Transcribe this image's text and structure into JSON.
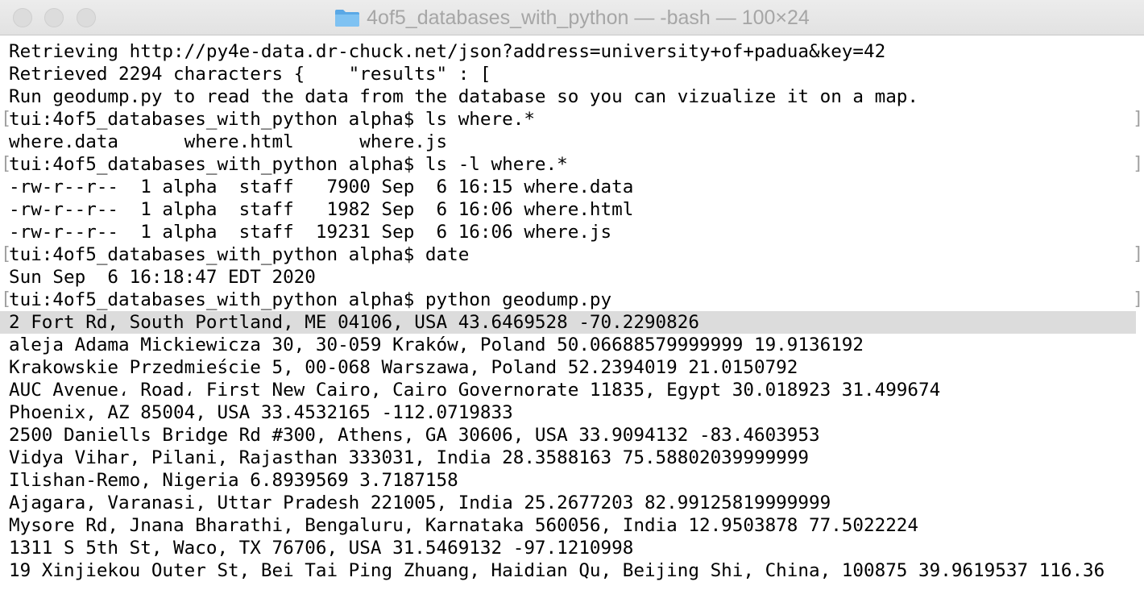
{
  "window": {
    "title": "4of5_databases_with_python — -bash — 100×24",
    "folder_icon": "folder-icon",
    "colors": {
      "titlebar": "#e6e6e6",
      "title_text": "#a6a6a6",
      "highlight": "#dcdcdc",
      "folder": "#6fb3e8"
    }
  },
  "terminal": {
    "lines": [
      {
        "text": "Retrieving http://py4e-data.dr-chuck.net/json?address=university+of+padua&key=42",
        "kind": "output"
      },
      {
        "text": "Retrieved 2294 characters {    \"results\" : [",
        "kind": "output"
      },
      {
        "text": "Run geodump.py to read the data from the database so you can vizualize it on a map.",
        "kind": "output"
      },
      {
        "text": "tui:4of5_databases_with_python alpha$ ls where.*",
        "kind": "prompt"
      },
      {
        "text": "where.data      where.html      where.js",
        "kind": "output"
      },
      {
        "text": "tui:4of5_databases_with_python alpha$ ls -l where.*",
        "kind": "prompt"
      },
      {
        "text": "-rw-r--r--  1 alpha  staff   7900 Sep  6 16:15 where.data",
        "kind": "output"
      },
      {
        "text": "-rw-r--r--  1 alpha  staff   1982 Sep  6 16:06 where.html",
        "kind": "output"
      },
      {
        "text": "-rw-r--r--  1 alpha  staff  19231 Sep  6 16:06 where.js",
        "kind": "output"
      },
      {
        "text": "tui:4of5_databases_with_python alpha$ date",
        "kind": "prompt"
      },
      {
        "text": "Sun Sep  6 16:18:47 EDT 2020",
        "kind": "output"
      },
      {
        "text": "tui:4of5_databases_with_python alpha$ python geodump.py",
        "kind": "prompt"
      },
      {
        "text": "2 Fort Rd, South Portland, ME 04106, USA 43.6469528 -70.2290826",
        "kind": "highlight"
      },
      {
        "text": "aleja Adama Mickiewicza 30, 30-059 Kraków, Poland 50.06688579999999 19.9136192",
        "kind": "output"
      },
      {
        "text": "Krakowskie Przedmieście 5, 00-068 Warszawa, Poland 52.2394019 21.0150792",
        "kind": "output"
      },
      {
        "text": "AUC Avenue، Road، First New Cairo, Cairo Governorate 11835, Egypt 30.018923 31.499674",
        "kind": "output"
      },
      {
        "text": "Phoenix, AZ 85004, USA 33.4532165 -112.0719833",
        "kind": "output"
      },
      {
        "text": "2500 Daniells Bridge Rd #300, Athens, GA 30606, USA 33.9094132 -83.4603953",
        "kind": "output"
      },
      {
        "text": "Vidya Vihar, Pilani, Rajasthan 333031, India 28.3588163 75.58802039999999",
        "kind": "output"
      },
      {
        "text": "Ilishan-Remo, Nigeria 6.8939569 3.7187158",
        "kind": "output"
      },
      {
        "text": "Ajagara, Varanasi, Uttar Pradesh 221005, India 25.2677203 82.99125819999999",
        "kind": "output"
      },
      {
        "text": "Mysore Rd, Jnana Bharathi, Bengaluru, Karnataka 560056, India 12.9503878 77.5022224",
        "kind": "output"
      },
      {
        "text": "1311 S 5th St, Waco, TX 76706, USA 31.5469132 -97.1210998",
        "kind": "output"
      },
      {
        "text": "19 Xinjiekou Outer St, Bei Tai Ping Zhuang, Haidian Qu, Beijing Shi, China, 100875 39.9619537 116.36",
        "kind": "output"
      }
    ]
  }
}
